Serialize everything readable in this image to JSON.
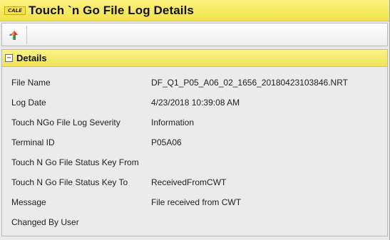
{
  "window": {
    "logo_text": "CALE",
    "title": "Touch `n Go File Log Details"
  },
  "toolbar": {
    "buttons": [
      {
        "icon": "upload-arrow-icon"
      }
    ]
  },
  "details": {
    "toggle_symbol": "−",
    "title": "Details",
    "fields": [
      {
        "label": "File Name",
        "value": "DF_Q1_P05_A06_02_1656_20180423103846.NRT"
      },
      {
        "label": "Log Date",
        "value": "4/23/2018 10:39:08 AM"
      },
      {
        "label": "Touch NGo File Log Severity",
        "value": "Information"
      },
      {
        "label": "Terminal ID",
        "value": "P05A06"
      },
      {
        "label": "Touch N Go File Status Key From",
        "value": ""
      },
      {
        "label": "Touch N Go File Status Key To",
        "value": "ReceivedFromCWT"
      },
      {
        "label": "Message",
        "value": "File received from CWT"
      },
      {
        "label": "Changed By User",
        "value": ""
      }
    ]
  },
  "colors": {
    "title_bar": "#f4e452",
    "section_header": "#f3e66a",
    "panel_background": "#ebebeb"
  }
}
